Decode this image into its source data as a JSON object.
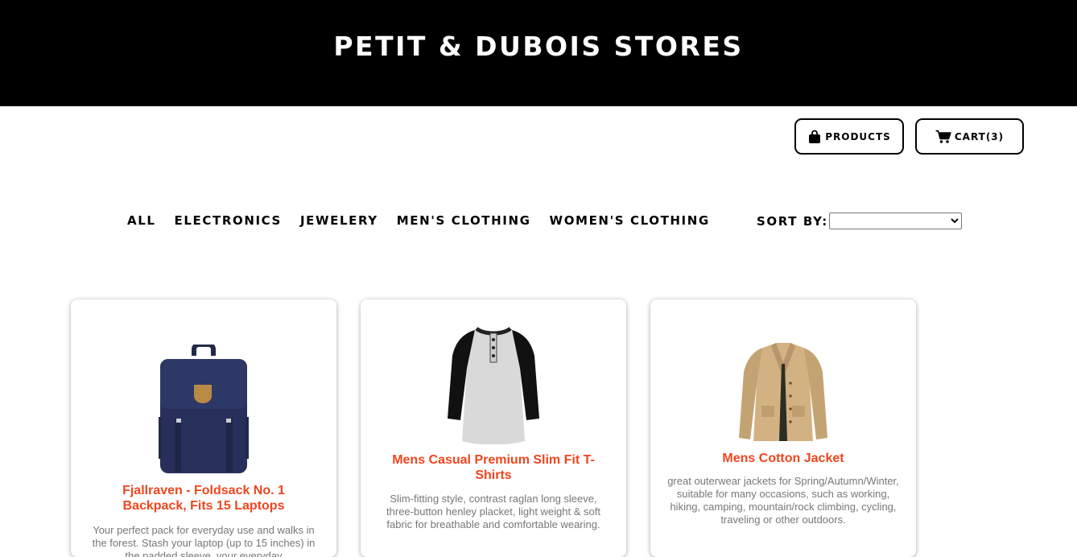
{
  "header": {
    "store_name": "PETIT & DUBOIS STORES"
  },
  "nav": {
    "products_label": "PRODUCTS",
    "products_icon": "shopping-bag-icon",
    "cart_label": "CART(3)",
    "cart_icon": "cart-icon"
  },
  "categories": [
    "ALL",
    "ELECTRONICS",
    "JEWELERY",
    "MEN'S CLOTHING",
    "WOMEN'S CLOTHING"
  ],
  "sort": {
    "label": "SORT BY:",
    "selected": ""
  },
  "products": [
    {
      "title": "Fjallraven - Foldsack No. 1 Backpack, Fits 15 Laptops",
      "description": "Your perfect pack for everyday use and walks in the forest. Stash your laptop (up to 15 inches) in the padded sleeve, your everyday"
    },
    {
      "title": "Mens Casual Premium Slim Fit T-Shirts",
      "description": "Slim-fitting style, contrast raglan long sleeve, three-button henley placket, light weight & soft fabric for breathable and comfortable wearing."
    },
    {
      "title": "Mens Cotton Jacket",
      "description": "great outerwear jackets for Spring/Autumn/Winter, suitable for many occasions, such as working, hiking, camping, mountain/rock climbing, cycling, traveling or other outdoors."
    }
  ],
  "colors": {
    "header_bg": "#000000",
    "accent": "#f0451e",
    "description_text": "#777777"
  }
}
